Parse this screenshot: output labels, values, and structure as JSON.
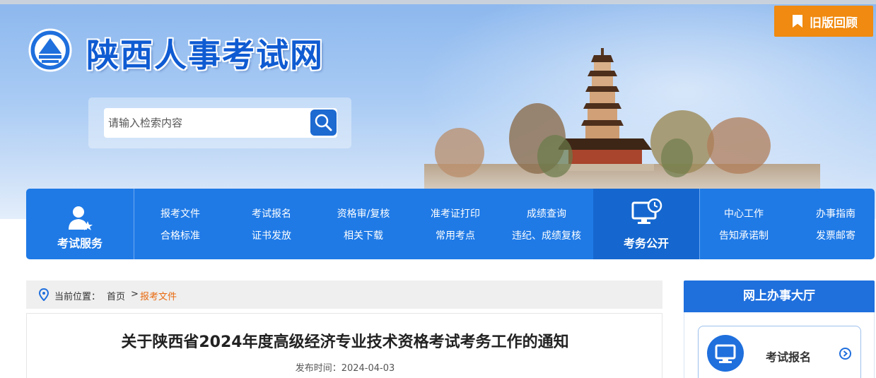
{
  "header": {
    "site_title": "陕西人事考试网",
    "old_version_label": "旧版回顾",
    "search": {
      "placeholder": "请输入检索内容"
    }
  },
  "nav": {
    "service_label": "考试服务",
    "public_label": "考务公开",
    "links_left": [
      [
        "报考文件",
        "合格标准"
      ],
      [
        "考试报名",
        "证书发放"
      ],
      [
        "资格审/复核",
        "相关下载"
      ],
      [
        "准考证打印",
        "常用考点"
      ],
      [
        "成绩查询",
        "违纪、成绩复核"
      ]
    ],
    "links_right": [
      [
        "中心工作",
        "告知承诺制"
      ],
      [
        "办事指南",
        "发票邮寄"
      ]
    ]
  },
  "breadcrumb": {
    "prefix": "当前位置：",
    "home": "首页",
    "separator": ">",
    "current": "报考文件"
  },
  "article": {
    "title": "关于陕西省2024年度高级经济专业技术资格考试考务工作的通知",
    "publish_label": "发布时间：",
    "publish_date": "2024-04-03"
  },
  "sidebar": {
    "heading": "网上办事大厅",
    "items": [
      {
        "label": "考试报名"
      }
    ]
  },
  "colors": {
    "primary": "#1f7ae6",
    "accent": "#f08a10",
    "breadcrumb_current": "#e86a10"
  }
}
